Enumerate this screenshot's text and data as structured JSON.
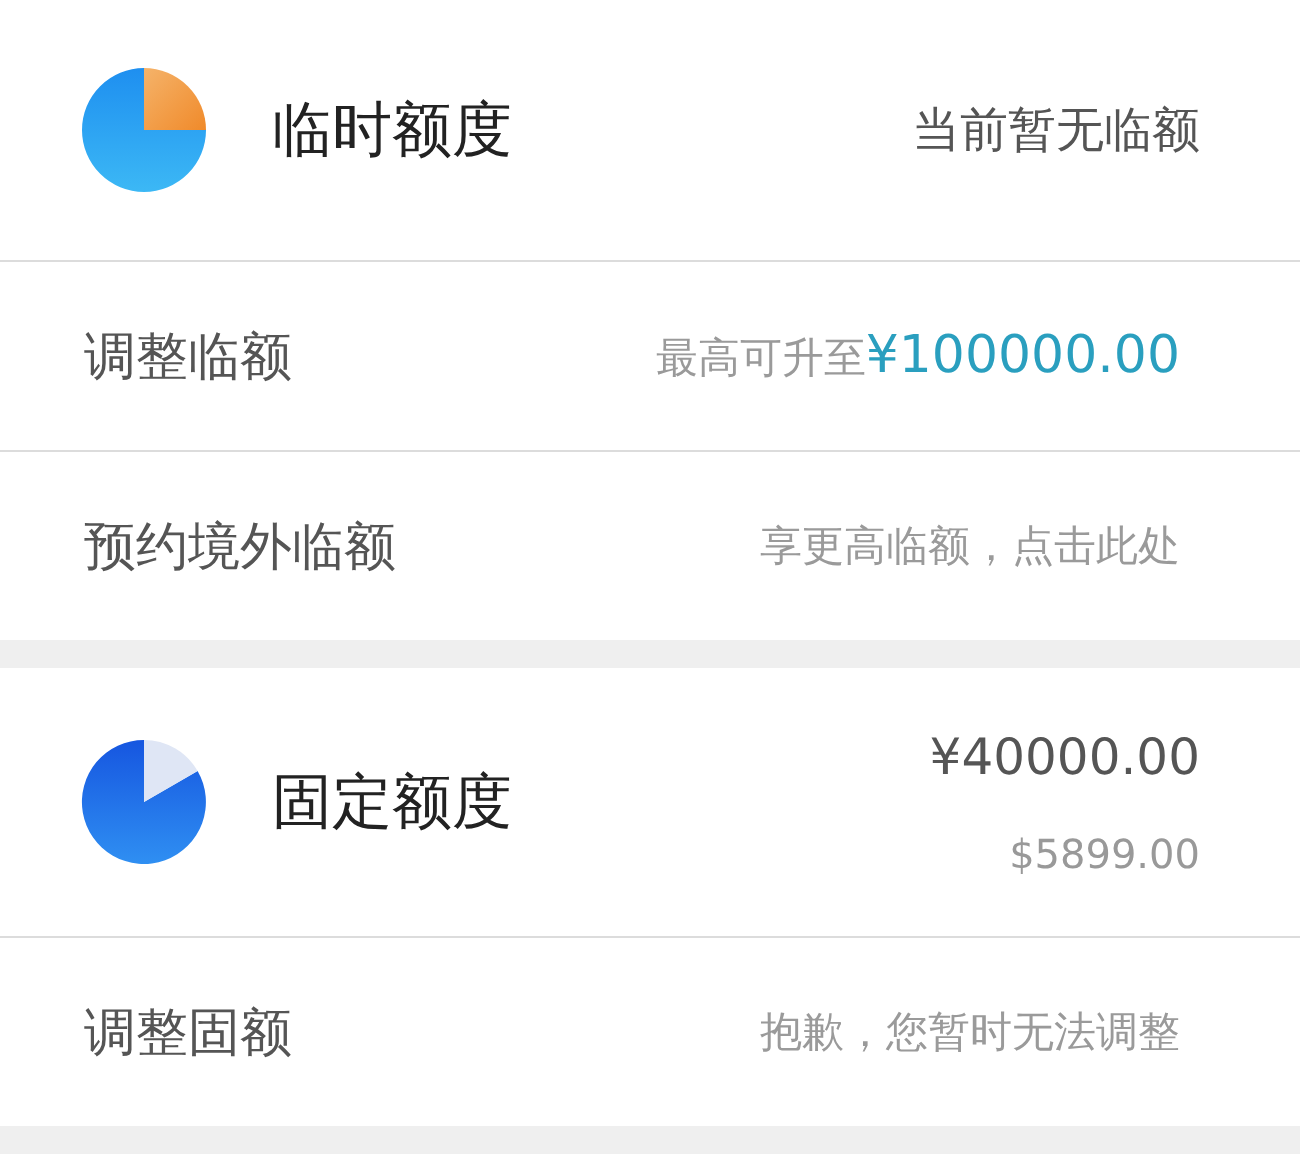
{
  "sections": [
    {
      "kind": "temporary",
      "title": "临时额度",
      "value": "当前暂无临额",
      "rows": [
        {
          "label": "调整临额",
          "value": "最高可升至",
          "amount": "¥100000.00"
        },
        {
          "label": "预约境外临额",
          "value": "享更高临额，点击此处"
        }
      ]
    },
    {
      "kind": "fixed",
      "title": "固定额度",
      "value": "¥40000.00",
      "subvalue": "$5899.00",
      "rows": [
        {
          "label": "调整固额",
          "value": "抱歉，您暂时无法调整"
        }
      ]
    }
  ]
}
